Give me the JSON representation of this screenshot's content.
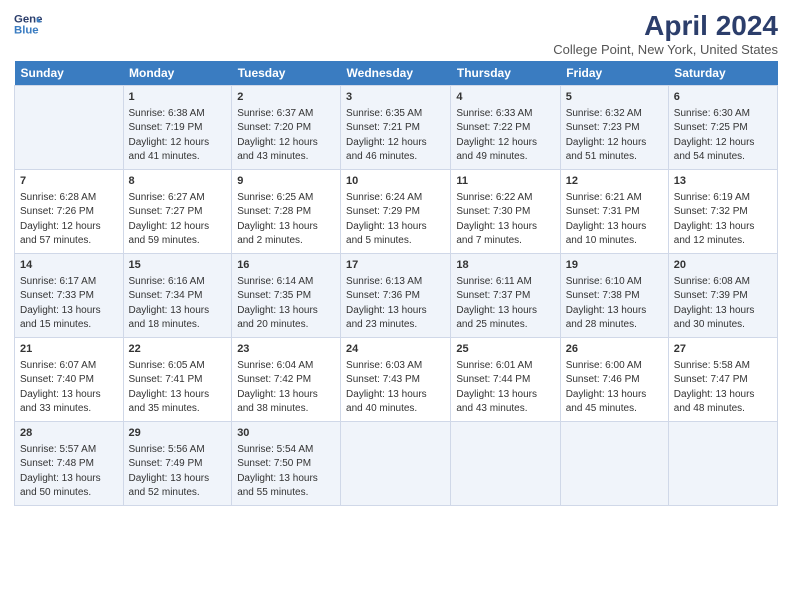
{
  "header": {
    "logo_line1": "General",
    "logo_line2": "Blue",
    "title": "April 2024",
    "subtitle": "College Point, New York, United States"
  },
  "columns": [
    "Sunday",
    "Monday",
    "Tuesday",
    "Wednesday",
    "Thursday",
    "Friday",
    "Saturday"
  ],
  "weeks": [
    [
      {
        "date": "",
        "info": ""
      },
      {
        "date": "1",
        "info": "Sunrise: 6:38 AM\nSunset: 7:19 PM\nDaylight: 12 hours\nand 41 minutes."
      },
      {
        "date": "2",
        "info": "Sunrise: 6:37 AM\nSunset: 7:20 PM\nDaylight: 12 hours\nand 43 minutes."
      },
      {
        "date": "3",
        "info": "Sunrise: 6:35 AM\nSunset: 7:21 PM\nDaylight: 12 hours\nand 46 minutes."
      },
      {
        "date": "4",
        "info": "Sunrise: 6:33 AM\nSunset: 7:22 PM\nDaylight: 12 hours\nand 49 minutes."
      },
      {
        "date": "5",
        "info": "Sunrise: 6:32 AM\nSunset: 7:23 PM\nDaylight: 12 hours\nand 51 minutes."
      },
      {
        "date": "6",
        "info": "Sunrise: 6:30 AM\nSunset: 7:25 PM\nDaylight: 12 hours\nand 54 minutes."
      }
    ],
    [
      {
        "date": "7",
        "info": "Sunrise: 6:28 AM\nSunset: 7:26 PM\nDaylight: 12 hours\nand 57 minutes."
      },
      {
        "date": "8",
        "info": "Sunrise: 6:27 AM\nSunset: 7:27 PM\nDaylight: 12 hours\nand 59 minutes."
      },
      {
        "date": "9",
        "info": "Sunrise: 6:25 AM\nSunset: 7:28 PM\nDaylight: 13 hours\nand 2 minutes."
      },
      {
        "date": "10",
        "info": "Sunrise: 6:24 AM\nSunset: 7:29 PM\nDaylight: 13 hours\nand 5 minutes."
      },
      {
        "date": "11",
        "info": "Sunrise: 6:22 AM\nSunset: 7:30 PM\nDaylight: 13 hours\nand 7 minutes."
      },
      {
        "date": "12",
        "info": "Sunrise: 6:21 AM\nSunset: 7:31 PM\nDaylight: 13 hours\nand 10 minutes."
      },
      {
        "date": "13",
        "info": "Sunrise: 6:19 AM\nSunset: 7:32 PM\nDaylight: 13 hours\nand 12 minutes."
      }
    ],
    [
      {
        "date": "14",
        "info": "Sunrise: 6:17 AM\nSunset: 7:33 PM\nDaylight: 13 hours\nand 15 minutes."
      },
      {
        "date": "15",
        "info": "Sunrise: 6:16 AM\nSunset: 7:34 PM\nDaylight: 13 hours\nand 18 minutes."
      },
      {
        "date": "16",
        "info": "Sunrise: 6:14 AM\nSunset: 7:35 PM\nDaylight: 13 hours\nand 20 minutes."
      },
      {
        "date": "17",
        "info": "Sunrise: 6:13 AM\nSunset: 7:36 PM\nDaylight: 13 hours\nand 23 minutes."
      },
      {
        "date": "18",
        "info": "Sunrise: 6:11 AM\nSunset: 7:37 PM\nDaylight: 13 hours\nand 25 minutes."
      },
      {
        "date": "19",
        "info": "Sunrise: 6:10 AM\nSunset: 7:38 PM\nDaylight: 13 hours\nand 28 minutes."
      },
      {
        "date": "20",
        "info": "Sunrise: 6:08 AM\nSunset: 7:39 PM\nDaylight: 13 hours\nand 30 minutes."
      }
    ],
    [
      {
        "date": "21",
        "info": "Sunrise: 6:07 AM\nSunset: 7:40 PM\nDaylight: 13 hours\nand 33 minutes."
      },
      {
        "date": "22",
        "info": "Sunrise: 6:05 AM\nSunset: 7:41 PM\nDaylight: 13 hours\nand 35 minutes."
      },
      {
        "date": "23",
        "info": "Sunrise: 6:04 AM\nSunset: 7:42 PM\nDaylight: 13 hours\nand 38 minutes."
      },
      {
        "date": "24",
        "info": "Sunrise: 6:03 AM\nSunset: 7:43 PM\nDaylight: 13 hours\nand 40 minutes."
      },
      {
        "date": "25",
        "info": "Sunrise: 6:01 AM\nSunset: 7:44 PM\nDaylight: 13 hours\nand 43 minutes."
      },
      {
        "date": "26",
        "info": "Sunrise: 6:00 AM\nSunset: 7:46 PM\nDaylight: 13 hours\nand 45 minutes."
      },
      {
        "date": "27",
        "info": "Sunrise: 5:58 AM\nSunset: 7:47 PM\nDaylight: 13 hours\nand 48 minutes."
      }
    ],
    [
      {
        "date": "28",
        "info": "Sunrise: 5:57 AM\nSunset: 7:48 PM\nDaylight: 13 hours\nand 50 minutes."
      },
      {
        "date": "29",
        "info": "Sunrise: 5:56 AM\nSunset: 7:49 PM\nDaylight: 13 hours\nand 52 minutes."
      },
      {
        "date": "30",
        "info": "Sunrise: 5:54 AM\nSunset: 7:50 PM\nDaylight: 13 hours\nand 55 minutes."
      },
      {
        "date": "",
        "info": ""
      },
      {
        "date": "",
        "info": ""
      },
      {
        "date": "",
        "info": ""
      },
      {
        "date": "",
        "info": ""
      }
    ]
  ]
}
